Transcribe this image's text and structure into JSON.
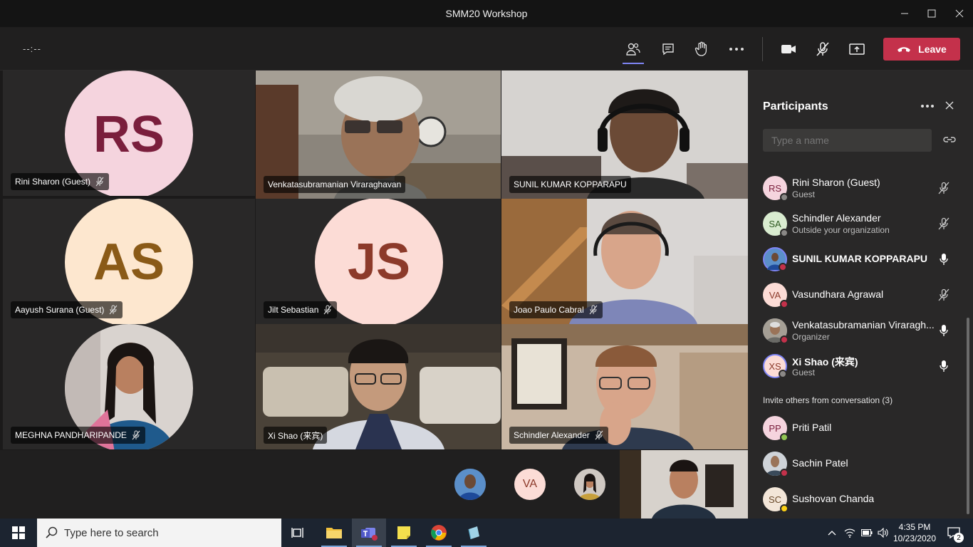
{
  "window": {
    "title": "SMM20 Workshop"
  },
  "toolbar": {
    "timer": "--:--",
    "leave_label": "Leave"
  },
  "tiles": [
    {
      "name": "Rini Sharon (Guest)",
      "initials": "RS",
      "muted": true
    },
    {
      "name": "Venkatasubramanian Viraraghavan",
      "muted": false
    },
    {
      "name": "SUNIL KUMAR KOPPARAPU",
      "muted": false
    },
    {
      "name": "Aayush Surana (Guest)",
      "initials": "AS",
      "muted": true
    },
    {
      "name": "Jilt Sebastian",
      "initials": "JS",
      "muted": true
    },
    {
      "name": "Joao Paulo Cabral",
      "muted": true
    },
    {
      "name": "MEGHNA PANDHARIPANDE",
      "muted": true
    },
    {
      "name": "Xi Shao (来宾)",
      "muted": false
    },
    {
      "name": "Schindler Alexander",
      "muted": true
    }
  ],
  "overflow": {
    "va_initials": "VA"
  },
  "participants_panel": {
    "title": "Participants",
    "search_placeholder": "Type a name",
    "items": [
      {
        "name": "Rini Sharon (Guest)",
        "sub": "Guest",
        "initials": "RS",
        "mic": "muted",
        "status": "offline"
      },
      {
        "name": "Schindler Alexander",
        "sub": "Outside your organization",
        "initials": "SA",
        "mic": "muted",
        "status": "blocked"
      },
      {
        "name": "SUNIL KUMAR KOPPARAPU",
        "sub": "",
        "initials": "",
        "mic": "on",
        "status": "busy",
        "bold": true
      },
      {
        "name": "Vasundhara Agrawal",
        "sub": "",
        "initials": "VA",
        "mic": "muted",
        "status": "busy"
      },
      {
        "name": "Venkatasubramanian Viraragh...",
        "sub": "Organizer",
        "initials": "",
        "mic": "on",
        "status": "busy"
      },
      {
        "name": "Xi Shao (来宾)",
        "sub": "Guest",
        "initials": "XS",
        "mic": "on",
        "status": "offline",
        "bold": true
      }
    ],
    "invite_section": "Invite others from conversation (3)",
    "invite_items": [
      {
        "name": "Priti Patil",
        "initials": "PP",
        "status": "available"
      },
      {
        "name": "Sachin Patel",
        "initials": "",
        "status": "busy"
      },
      {
        "name": "Sushovan Chanda",
        "initials": "SC",
        "status": "away"
      }
    ]
  },
  "taskbar": {
    "search_placeholder": "Type here to search",
    "time": "4:35 PM",
    "date": "10/23/2020",
    "notification_count": "2"
  },
  "colors": {
    "leave": "#c4314b",
    "accent": "#7f85f5",
    "busy": "#c4314b",
    "available": "#92c353",
    "away": "#fcd116"
  }
}
